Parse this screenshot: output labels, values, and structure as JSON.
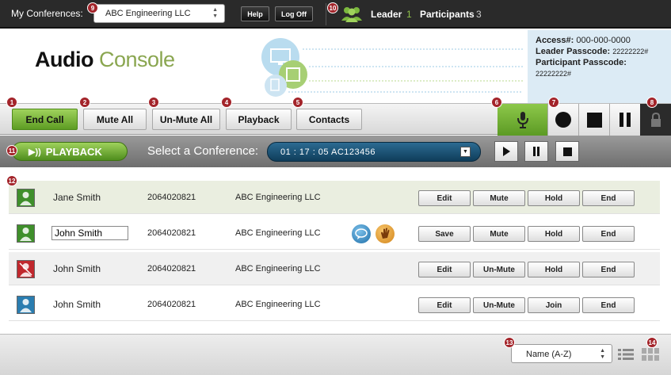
{
  "topbar": {
    "conferences_label": "My Conferences:",
    "conference_value": "ABC Engineering LLC",
    "help_label": "Help",
    "logoff_label": "Log Off",
    "leader_label": "Leader",
    "leader_count": "1",
    "participants_label": "Participants",
    "participants_count": "3"
  },
  "header": {
    "title_part1": "Audio",
    "title_part2": "Console",
    "access_label": "Access#:",
    "access_value": "000-000-0000",
    "leader_passcode_label": "Leader Passcode:",
    "leader_passcode_value": "22222222#",
    "participant_passcode_label": "Participant Passcode:",
    "participant_passcode_value": "22222222#"
  },
  "toolbar": {
    "end_call": "End Call",
    "mute_all": "Mute All",
    "unmute_all": "Un-Mute All",
    "playback": "Playback",
    "contacts": "Contacts"
  },
  "confbar": {
    "playback_label": "PLAYBACK",
    "select_label": "Select a Conference:",
    "conference_value": "01 : 17 : 05  AC123456"
  },
  "participants": [
    {
      "name": "Jane Smith",
      "phone": "2064020821",
      "company": "ABC Engineering LLC",
      "btn1": "Edit",
      "btn2": "Mute",
      "btn3": "Hold",
      "btn4": "End",
      "editing": false,
      "avatar_color": "#3f8f2b"
    },
    {
      "name": "John Smith",
      "phone": "2064020821",
      "company": "ABC Engineering LLC",
      "btn1": "Save",
      "btn2": "Mute",
      "btn3": "Hold",
      "btn4": "End",
      "editing": true,
      "avatar_color": "#3f8f2b"
    },
    {
      "name": "John Smith",
      "phone": "2064020821",
      "company": "ABC Engineering LLC",
      "btn1": "Edit",
      "btn2": "Un-Mute",
      "btn3": "Hold",
      "btn4": "End",
      "editing": false,
      "avatar_color": "#c0282d"
    },
    {
      "name": "John Smith",
      "phone": "2064020821",
      "company": "ABC Engineering LLC",
      "btn1": "Edit",
      "btn2": "Un-Mute",
      "btn3": "Join",
      "btn4": "End",
      "editing": false,
      "avatar_color": "#2a7db0"
    }
  ],
  "footer": {
    "sort_value": "Name (A-Z)"
  },
  "badges": [
    "1",
    "2",
    "3",
    "4",
    "5",
    "6",
    "7",
    "8",
    "9",
    "10",
    "11",
    "12",
    "13",
    "14"
  ],
  "colors": {
    "accent_green": "#8aa650",
    "button_green": "#7cb83e",
    "badge_red": "#a3242a",
    "info_bg": "#dcebf5",
    "conf_dropdown": "#1d5478"
  }
}
